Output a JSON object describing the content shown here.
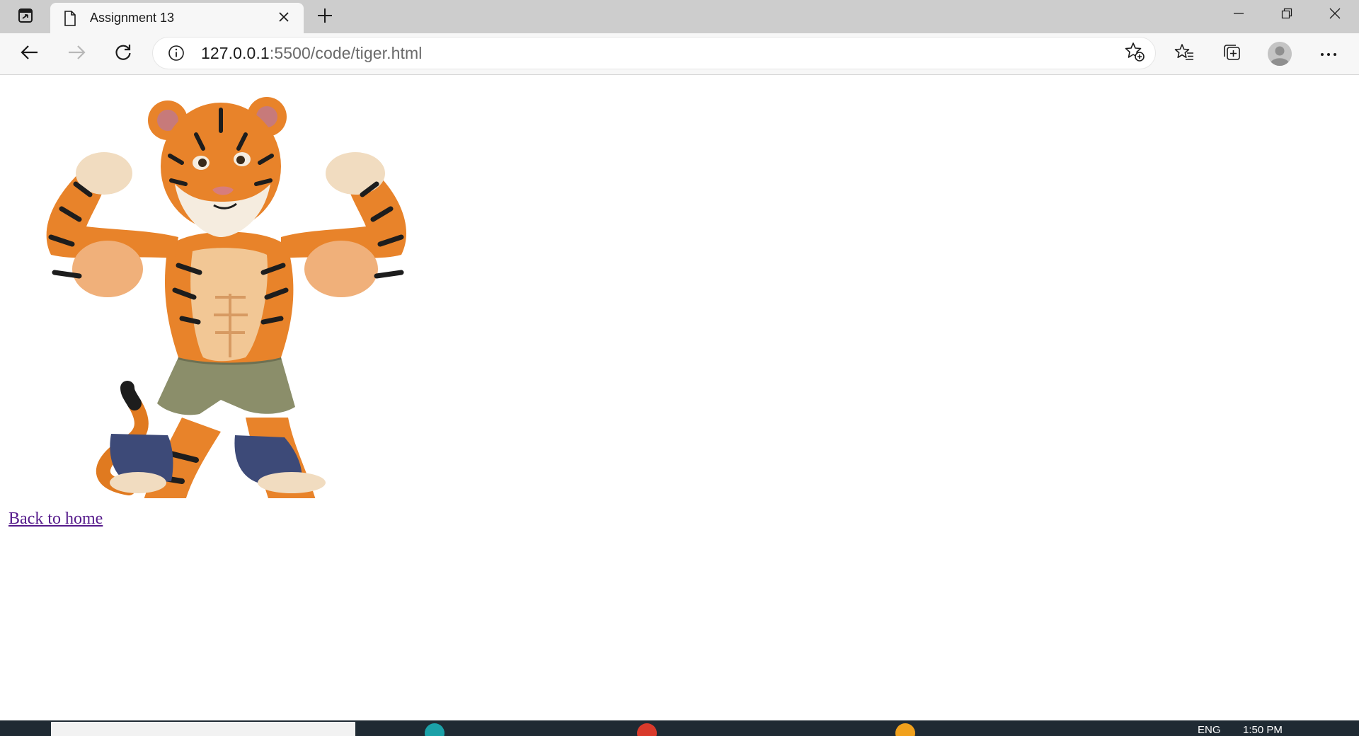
{
  "browser": {
    "tab": {
      "title": "Assignment 13"
    },
    "address_bar": {
      "host": "127.0.0.1",
      "path": ":5500/code/tiger.html"
    }
  },
  "page": {
    "image": {
      "subject": "muscular cartoon tiger flexing"
    },
    "link": {
      "label": "Back to home",
      "color": "#551a8b"
    }
  },
  "taskbar": {
    "language": "ENG",
    "time": "1:50 PM"
  },
  "colors": {
    "tabstrip": "#cdcdcd",
    "toolbar": "#f7f7f7",
    "taskbar": "#1f2a33",
    "visited_link": "#551a8b"
  },
  "icons": {
    "tab_actions": "tab-actions-icon",
    "page": "page-icon",
    "close": "close-icon",
    "new_tab": "plus-icon",
    "minimize": "minimize-icon",
    "restore": "restore-icon",
    "window_close": "close-icon",
    "back": "arrow-left-icon",
    "forward": "arrow-right-icon",
    "refresh": "refresh-icon",
    "info": "info-icon",
    "add_favorite": "star-add-icon",
    "favorites": "favorites-icon",
    "collections": "collections-icon",
    "profile": "avatar-icon",
    "more": "more-icon"
  }
}
